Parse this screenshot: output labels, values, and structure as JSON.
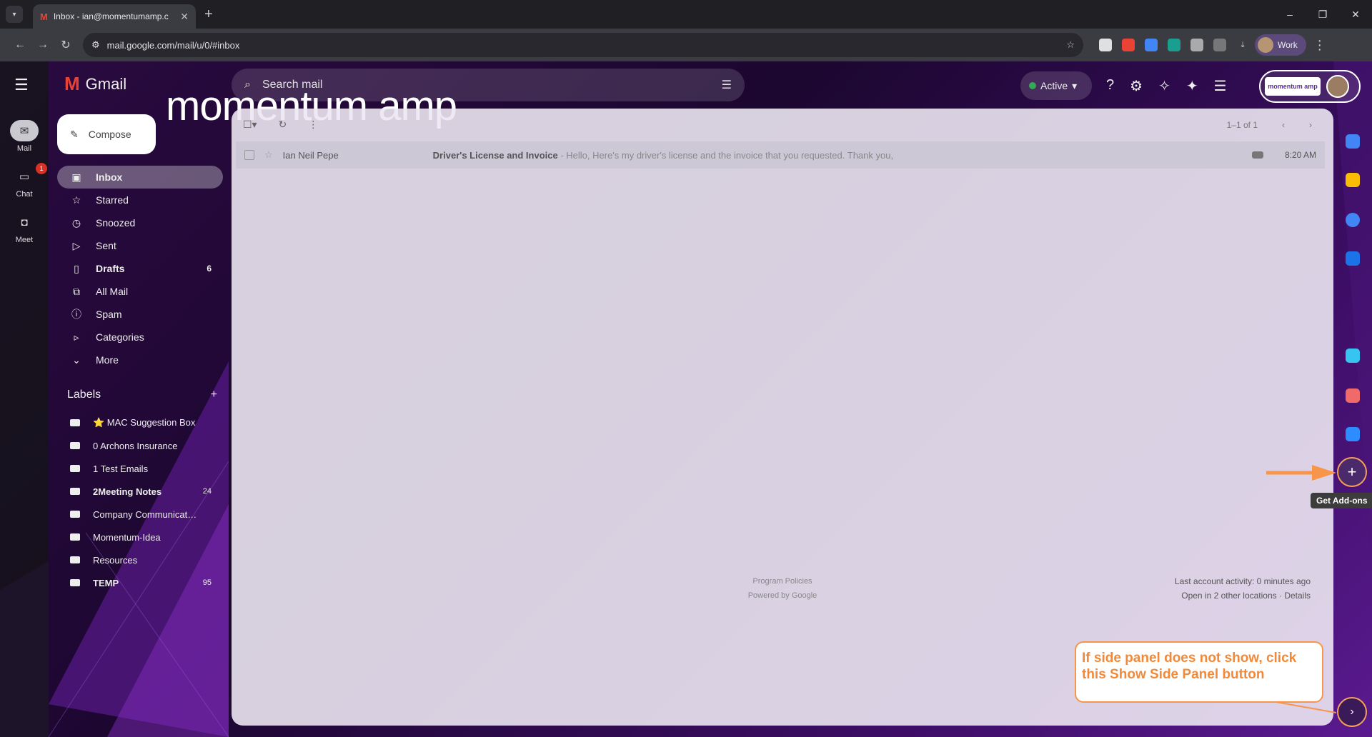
{
  "browser": {
    "tab_title": "Inbox - ian@momentumamp.c",
    "tab_favicon": "M",
    "tab_close": "✕",
    "new_tab": "+",
    "url": "mail.google.com/mail/u/0/#inbox",
    "profile_label": "Work",
    "window_controls": [
      "–",
      "❐",
      "✕"
    ]
  },
  "gmail": {
    "app_name": "Gmail",
    "brand_text": "momentum amp",
    "search_placeholder": "Search mail",
    "status": "Active",
    "compose_label": "Compose",
    "account_org": "momentum amp",
    "rail": [
      {
        "label": "Mail",
        "icon": "mail-icon",
        "active": true
      },
      {
        "label": "Chat",
        "icon": "chat-icon",
        "badge": "1"
      },
      {
        "label": "Meet",
        "icon": "video-icon"
      }
    ],
    "nav": [
      {
        "label": "Inbox",
        "icon": "inbox-icon",
        "active": true,
        "count": ""
      },
      {
        "label": "Starred",
        "icon": "star-icon",
        "count": ""
      },
      {
        "label": "Snoozed",
        "icon": "clock-icon",
        "count": ""
      },
      {
        "label": "Sent",
        "icon": "send-icon",
        "count": ""
      },
      {
        "label": "Drafts",
        "icon": "draft-icon",
        "count": "6"
      },
      {
        "label": "All Mail",
        "icon": "all-mail-icon",
        "count": ""
      },
      {
        "label": "Spam",
        "icon": "spam-icon",
        "count": ""
      },
      {
        "label": "Categories",
        "icon": "label-icon",
        "count": ""
      },
      {
        "label": "More",
        "icon": "chevron-down-icon",
        "count": ""
      }
    ],
    "labels_title": "Labels",
    "labels_add": "+",
    "labels": [
      {
        "label": "⭐ MAC Suggestion Box",
        "count": ""
      },
      {
        "label": "0 Archons Insurance",
        "count": ""
      },
      {
        "label": "1 Test Emails",
        "count": ""
      },
      {
        "label": "2Meeting Notes",
        "count": "24",
        "bold": true
      },
      {
        "label": "Company Communicatio...",
        "count": ""
      },
      {
        "label": "Momentum-Idea",
        "count": ""
      },
      {
        "label": "Resources",
        "count": ""
      },
      {
        "label": "TEMP",
        "count": "95",
        "bold": true
      }
    ],
    "pager_text": "1–1 of 1",
    "email": {
      "sender": "Ian Neil Pepe",
      "subject": "Driver's License and Invoice",
      "snippet": " - Hello, Here's my driver's license and the invoice that you requested. Thank you,",
      "time": "8:20 AM"
    },
    "footer_center": [
      "Program Policies",
      "Powered by Google"
    ],
    "footer_right": [
      "Last account activity: 0 minutes ago",
      "Open in 2 other locations · Details"
    ],
    "addon_button": "+",
    "addon_tooltip": "Get Add-ons",
    "show_panel": "›",
    "callout_text": "If side panel does not show, click this Show Side Panel button"
  }
}
